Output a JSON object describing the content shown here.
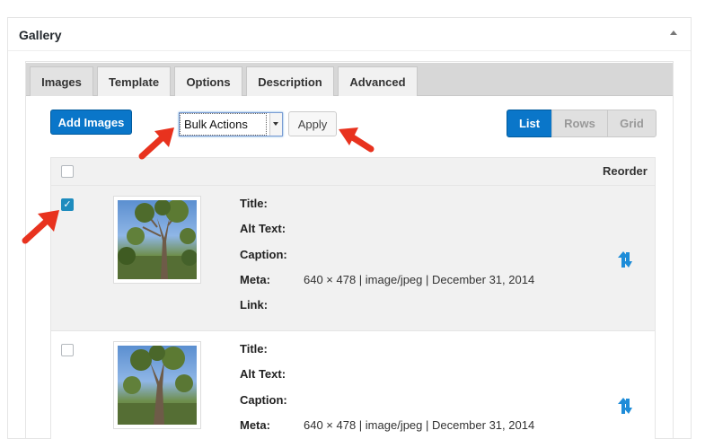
{
  "panel": {
    "title": "Gallery"
  },
  "tabs": [
    {
      "label": "Images"
    },
    {
      "label": "Template"
    },
    {
      "label": "Options"
    },
    {
      "label": "Description"
    },
    {
      "label": "Advanced"
    }
  ],
  "toolbar": {
    "add_images_label": "Add Images",
    "bulk_actions_selected": "Bulk Actions",
    "apply_label": "Apply"
  },
  "view_modes": [
    {
      "label": "List",
      "active": true
    },
    {
      "label": "Rows",
      "active": false
    },
    {
      "label": "Grid",
      "active": false
    }
  ],
  "table": {
    "reorder_header": "Reorder",
    "fields": [
      "Title:",
      "Alt Text:",
      "Caption:",
      "Meta:",
      "Link:"
    ],
    "rows": [
      {
        "checked": true,
        "title": "",
        "alt_text": "",
        "caption": "",
        "meta": "640 × 478 | image/jpeg | December 31, 2014",
        "link": ""
      },
      {
        "checked": false,
        "title": "",
        "alt_text": "",
        "caption": "",
        "meta": "640 × 478 | image/jpeg | December 31, 2014",
        "link": ""
      }
    ]
  },
  "icons": {
    "collapse": "triangle-up-icon",
    "reorder": "reorder-arrows-icon",
    "annotation": "red-arrow-icon"
  },
  "colors": {
    "primary": "#0a76c9",
    "annotation": "#e8321e",
    "reorder": "#1e8cd8"
  }
}
